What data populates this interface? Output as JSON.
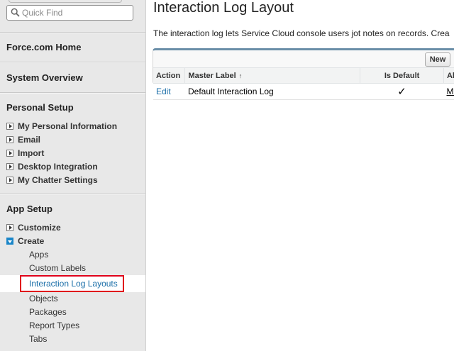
{
  "sidebar": {
    "search": {
      "placeholder": "Quick Find",
      "value": ""
    },
    "home_label": "Force.com Home",
    "overview_label": "System Overview",
    "personal_setup": {
      "heading": "Personal Setup",
      "items": [
        {
          "label": "My Personal Information"
        },
        {
          "label": "Email"
        },
        {
          "label": "Import"
        },
        {
          "label": "Desktop Integration"
        },
        {
          "label": "My Chatter Settings"
        }
      ]
    },
    "app_setup": {
      "heading": "App Setup",
      "items": [
        {
          "label": "Customize",
          "expanded": false
        },
        {
          "label": "Create",
          "expanded": true
        }
      ],
      "create_children": [
        {
          "label": "Apps"
        },
        {
          "label": "Custom Labels"
        },
        {
          "label": "Interaction Log Layouts",
          "selected": true
        },
        {
          "label": "Objects"
        },
        {
          "label": "Packages"
        },
        {
          "label": "Report Types"
        },
        {
          "label": "Tabs"
        }
      ]
    }
  },
  "main": {
    "title": "Interaction Log Layout",
    "description": "The interaction log lets Service Cloud console users jot notes on records. Crea",
    "new_button": "New",
    "table": {
      "columns": {
        "action": "Action",
        "master_label": "Master Label",
        "sort_indicator": "↑",
        "is_default": "Is Default",
        "alias": "Alia"
      },
      "rows": [
        {
          "action": "Edit",
          "master_label": "Default Interaction Log",
          "is_default": "✓",
          "alias": "MD"
        }
      ]
    }
  },
  "colors": {
    "link": "#1a6ea8",
    "highlight_box": "#e0001b",
    "panel_top_border": "#6a8ea8",
    "sidebar_bg": "#e8e8e8"
  },
  "icons": [
    "search-icon",
    "collapsed-arrow-icon",
    "expanded-arrow-icon",
    "check-icon"
  ]
}
